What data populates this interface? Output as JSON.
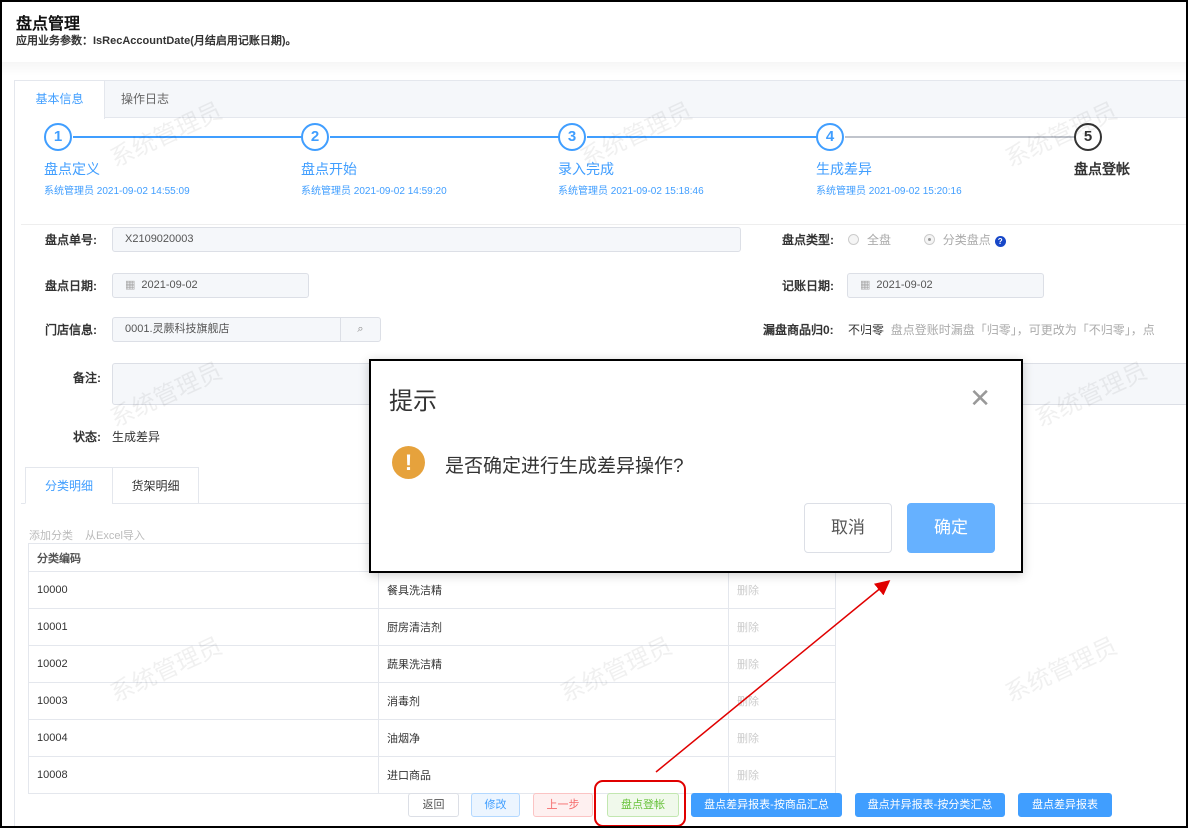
{
  "header": {
    "title": "盘点管理",
    "subtitle": "应用业务参数：IsRecAccountDate(月结启用记账日期)。"
  },
  "tabs": [
    {
      "label": "基本信息",
      "active": true
    },
    {
      "label": "操作日志",
      "active": false
    }
  ],
  "steps": [
    {
      "num": "1",
      "label": "盘点定义",
      "sub": "系统管理员 2021-09-02 14:55:09"
    },
    {
      "num": "2",
      "label": "盘点开始",
      "sub": "系统管理员 2021-09-02 14:59:20"
    },
    {
      "num": "3",
      "label": "录入完成",
      "sub": "系统管理员 2021-09-02 15:18:46"
    },
    {
      "num": "4",
      "label": "生成差异",
      "sub": "系统管理员 2021-09-02 15:20:16"
    },
    {
      "num": "5",
      "label": "盘点登帐",
      "sub": ""
    }
  ],
  "form": {
    "order_no_label": "盘点单号:",
    "order_no": "X2109020003",
    "type_label": "盘点类型:",
    "type_options": [
      "全盘",
      "分类盘点"
    ],
    "type_selected": "分类盘点",
    "date_label": "盘点日期:",
    "date": "2021-09-02",
    "acct_date_label": "记账日期:",
    "acct_date": "2021-09-02",
    "store_label": "门店信息:",
    "store": "0001.灵蕨科技旗舰店",
    "zero_label": "漏盘商品归0:",
    "zero_value": "不归零",
    "zero_hint": "盘点登账时漏盘「归零」，可更改为「不归零」，点",
    "remark_label": "备注:",
    "remark": "",
    "status_label": "状态:",
    "status": "生成差异"
  },
  "subtabs": [
    {
      "label": "分类明细",
      "active": true
    },
    {
      "label": "货架明细",
      "active": false
    }
  ],
  "links": {
    "add": "添加分类",
    "import": "从Excel导入"
  },
  "table": {
    "headers": [
      "分类编码",
      "",
      ""
    ],
    "rows": [
      {
        "code": "10000",
        "name": "餐具洗洁精",
        "action": "删除"
      },
      {
        "code": "10001",
        "name": "厨房清洁剂",
        "action": "删除"
      },
      {
        "code": "10002",
        "name": "蔬果洗洁精",
        "action": "删除"
      },
      {
        "code": "10003",
        "name": "消毒剂",
        "action": "删除"
      },
      {
        "code": "10004",
        "name": "油烟净",
        "action": "删除"
      },
      {
        "code": "10008",
        "name": "进口商品",
        "action": "删除"
      }
    ]
  },
  "buttons": {
    "back": "返回",
    "edit": "修改",
    "prev": "上一步",
    "post": "盘点登帐",
    "report_goods": "盘点差异报表-按商品汇总",
    "report_cat": "盘点并异报表-按分类汇总",
    "report": "盘点差异报表"
  },
  "dialog": {
    "title": "提示",
    "message": "是否确定进行生成差异操作?",
    "cancel": "取消",
    "confirm": "确定"
  },
  "watermark": "系统管理员",
  "colors": {
    "primary": "#409eff",
    "warning": "#e6a23c",
    "success": "#67c23a",
    "danger": "#f56c6c",
    "annotation": "#e00000"
  }
}
